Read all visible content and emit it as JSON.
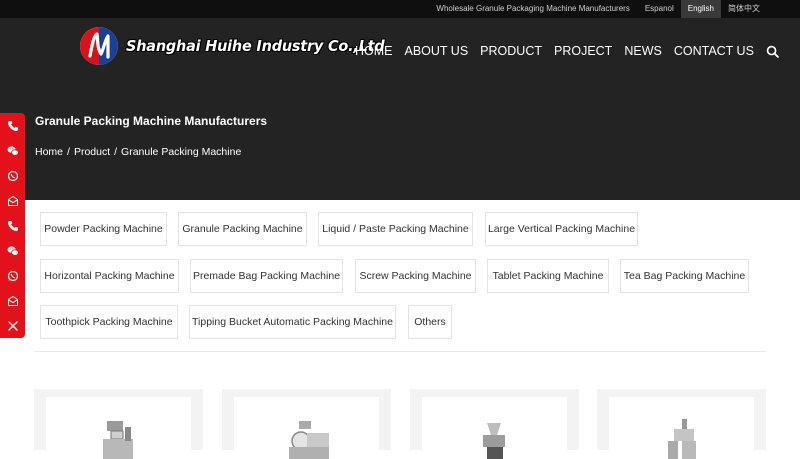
{
  "topbar": {
    "tagline": "Wholesale Granule Packaging Machine Manufacturers",
    "languages": [
      "Espanol",
      "English",
      "简体中文"
    ],
    "active_language": "English"
  },
  "header": {
    "logo_text": "Shanghai Huihe Industry Co.,Ltd",
    "nav": [
      "HOME",
      "ABOUT US",
      "PRODUCT",
      "PROJECT",
      "NEWS",
      "CONTACT US"
    ]
  },
  "hero": {
    "title": "Granule Packing Machine Manufacturers",
    "breadcrumb": [
      "Home",
      "Product",
      "Granule Packing Machine"
    ]
  },
  "sidebar": {
    "icons": [
      "phone-icon",
      "wechat-icon",
      "whatsapp-icon",
      "email-icon",
      "phone-icon",
      "wechat-icon",
      "whatsapp-icon",
      "email-icon",
      "close-icon"
    ]
  },
  "categories": [
    "Powder Packing Machine",
    "Granule Packing Machine",
    "Liquid / Paste Packing Machine",
    "Large Vertical Packing Machine",
    "Horizontal Packing Machine",
    "Premade Bag Packing Machine",
    "Screw Packing Machine",
    "Tablet Packing Machine",
    "Tea Bag Packing Machine",
    "Toothpick Packing Machine",
    "Tipping Bucket Automatic Packing Machine",
    "Others"
  ],
  "colors": {
    "accent_red": "#e3121a",
    "hero_bg": "#232323",
    "topbar_bg": "#0f0f0f"
  }
}
